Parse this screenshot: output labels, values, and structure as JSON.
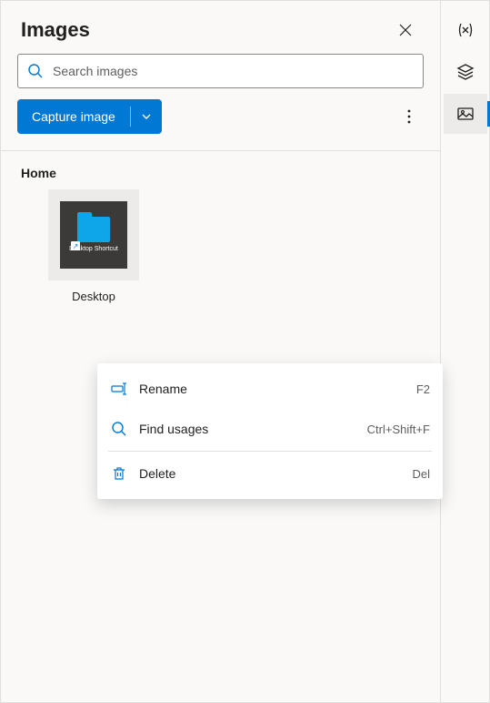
{
  "panel": {
    "title": "Images",
    "search_placeholder": "Search images",
    "capture_label": "Capture image"
  },
  "folder": {
    "name": "Home",
    "items": [
      {
        "caption": "Desktop",
        "inner_label": "Desktop\nShortcut"
      }
    ]
  },
  "context_menu": {
    "items": [
      {
        "label": "Rename",
        "shortcut": "F2",
        "icon": "rename-icon"
      },
      {
        "label": "Find usages",
        "shortcut": "Ctrl+Shift+F",
        "icon": "search-icon"
      },
      {
        "label": "Delete",
        "shortcut": "Del",
        "icon": "delete-icon"
      }
    ]
  },
  "rail": {
    "items": [
      {
        "name": "variables",
        "active": false
      },
      {
        "name": "layers",
        "active": false
      },
      {
        "name": "images",
        "active": true
      }
    ]
  }
}
